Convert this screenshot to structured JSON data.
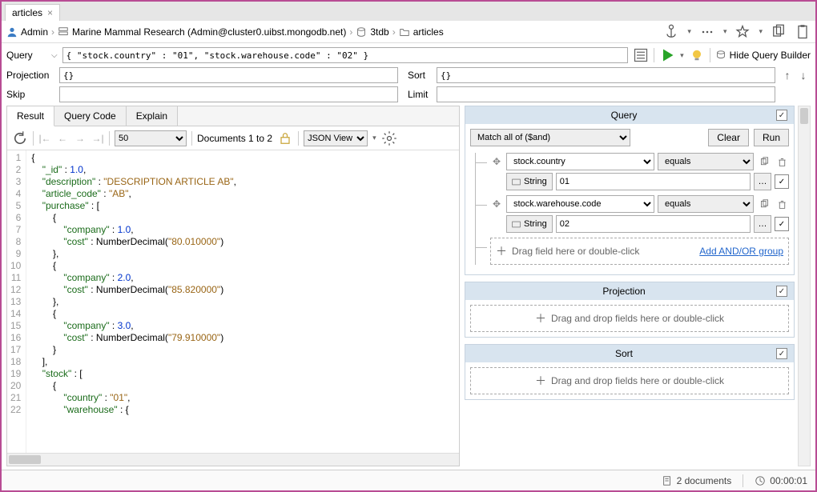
{
  "tab": {
    "name": "articles"
  },
  "breadcrumb": {
    "user": "Admin",
    "conn": "Marine Mammal Research (Admin@cluster0.uibst.mongodb.net)",
    "db": "3tdb",
    "coll": "articles"
  },
  "query_row": {
    "label": "Query",
    "text": "{ \"stock.country\" : \"01\", \"stock.warehouse.code\" : \"02\" }",
    "hide_builder": "Hide Query Builder"
  },
  "fields": {
    "projection_label": "Projection",
    "projection_value": "{}",
    "sort_label": "Sort",
    "sort_value": "{}",
    "skip_label": "Skip",
    "skip_value": "",
    "limit_label": "Limit",
    "limit_value": ""
  },
  "left_tabs": [
    "Result",
    "Query Code",
    "Explain"
  ],
  "result_toolbar": {
    "page_size": "50",
    "docs_range": "Documents 1 to 2",
    "view_mode": "JSON View"
  },
  "json_lines": [
    "{",
    "    \"_id\" : 1.0,",
    "    \"description\" : \"DESCRIPTION ARTICLE AB\",",
    "    \"article_code\" : \"AB\",",
    "    \"purchase\" : [",
    "        {",
    "            \"company\" : 1.0,",
    "            \"cost\" : NumberDecimal(\"80.010000\")",
    "        },",
    "        {",
    "            \"company\" : 2.0,",
    "            \"cost\" : NumberDecimal(\"85.820000\")",
    "        },",
    "        {",
    "            \"company\" : 3.0,",
    "            \"cost\" : NumberDecimal(\"79.910000\")",
    "        }",
    "    ],",
    "    \"stock\" : [",
    "        {",
    "            \"country\" : \"01\",",
    "            \"warehouse\" : {"
  ],
  "qb": {
    "title": "Query",
    "match_mode": "Match all of ($and)",
    "clear": "Clear",
    "run": "Run",
    "conditions": [
      {
        "field": "stock.country",
        "op": "equals",
        "type": "String",
        "value": "01"
      },
      {
        "field": "stock.warehouse.code",
        "op": "equals",
        "type": "String",
        "value": "02"
      }
    ],
    "drop_hint": "Drag field here or double-click",
    "add_group": "Add AND/OR group",
    "projection_title": "Projection",
    "projection_hint": "Drag and drop fields here or double-click",
    "sort_title": "Sort",
    "sort_hint": "Drag and drop fields here or double-click"
  },
  "status": {
    "doc_count": "2 documents",
    "time": "00:00:01"
  }
}
